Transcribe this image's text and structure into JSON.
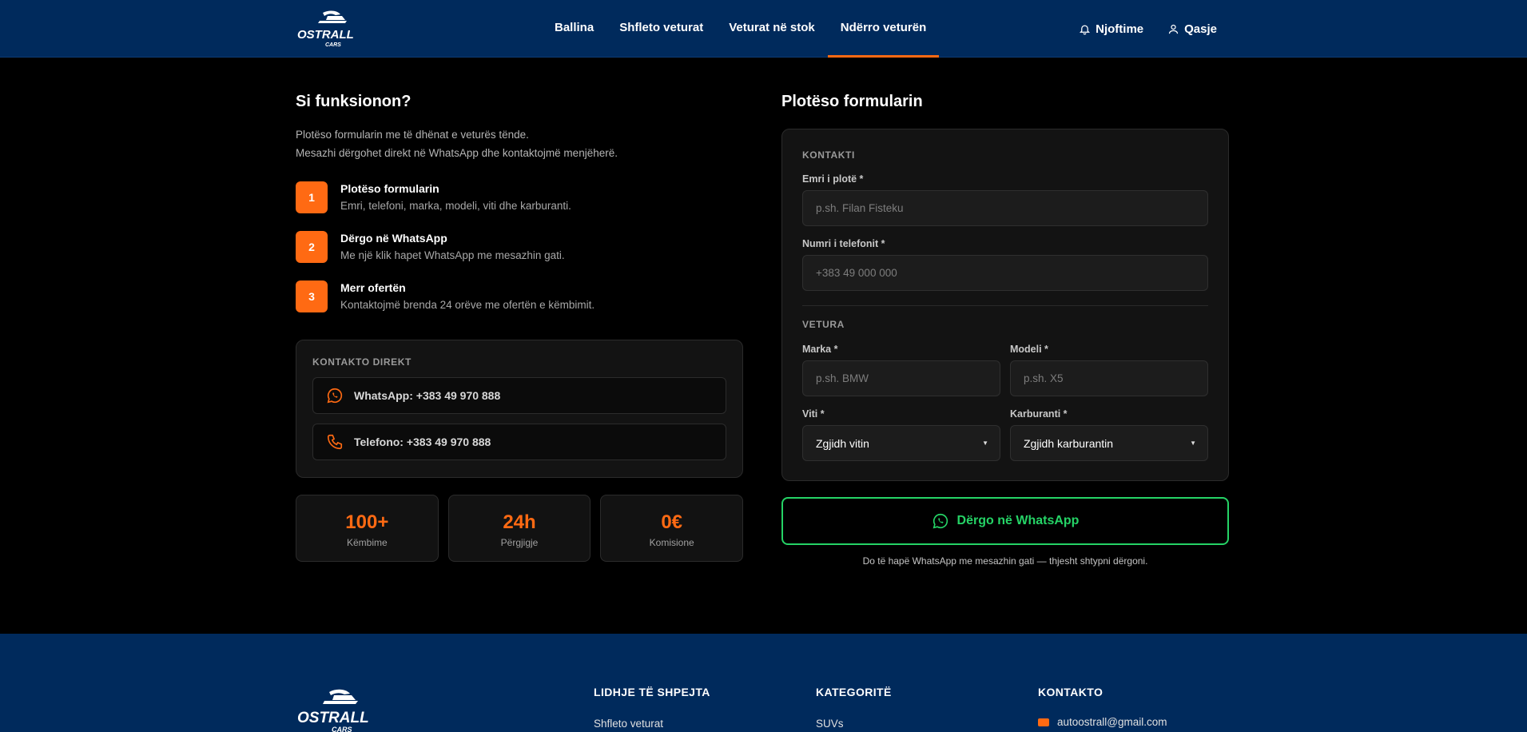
{
  "header": {
    "logo_text": "OSTRALL CARS",
    "nav": [
      "Ballina",
      "Shfleto veturat",
      "Veturat në stok",
      "Ndërro veturën"
    ],
    "active_nav": "Ndërro veturën",
    "notifications_label": "Njoftime",
    "login_label": "Qasje"
  },
  "how": {
    "title": "Si funksionon?",
    "intro_line1": "Plotëso formularin me të dhënat e veturës tënde.",
    "intro_line2": "Mesazhi dërgohet direkt në WhatsApp dhe kontaktojmë menjëherë.",
    "steps": [
      {
        "num": "1",
        "title": "Plotëso formularin",
        "desc": "Emri, telefoni, marka, modeli, viti dhe karburanti."
      },
      {
        "num": "2",
        "title": "Dërgo në WhatsApp",
        "desc": "Me një klik hapet WhatsApp me mesazhin gati."
      },
      {
        "num": "3",
        "title": "Merr ofertën",
        "desc": "Kontaktojmë brenda 24 orëve me ofertën e këmbimit."
      }
    ]
  },
  "direct": {
    "title": "KONTAKTO DIREKT",
    "whatsapp": "WhatsApp: +383 49 970 888",
    "phone": "Telefono: +383 49 970 888"
  },
  "stats": [
    {
      "value": "100+",
      "label": "Këmbime"
    },
    {
      "value": "24h",
      "label": "Përgjigje"
    },
    {
      "value": "0€",
      "label": "Komisione"
    }
  ],
  "form": {
    "title": "Plotëso formularin",
    "contact_group": "KONTAKTI",
    "name_label": "Emri i plotë *",
    "name_placeholder": "p.sh. Filan Fisteku",
    "phone_label": "Numri i telefonit *",
    "phone_placeholder": "+383 49 000 000",
    "car_group": "VETURA",
    "brand_label": "Marka *",
    "brand_placeholder": "p.sh. BMW",
    "model_label": "Modeli *",
    "model_placeholder": "p.sh. X5",
    "year_label": "Viti *",
    "year_value": "Zgjidh vitin",
    "fuel_label": "Karburanti *",
    "fuel_value": "Zgjidh karburantin",
    "submit_label": "Dërgo në WhatsApp",
    "note": "Do të hapë WhatsApp me mesazhin gati — thjesht shtypni dërgoni."
  },
  "footer": {
    "quick_links_title": "LIDHJE TË SHPEJTA",
    "quick_links_first": "Shfleto veturat",
    "categories_title": "KATEGORITË",
    "categories_first": "SUVs",
    "contact_title": "KONTAKTO",
    "email": "autoostrall@gmail.com"
  },
  "colors": {
    "header_bg": "#002a5c",
    "accent": "#ff6a13",
    "whatsapp_green": "#25d366"
  }
}
